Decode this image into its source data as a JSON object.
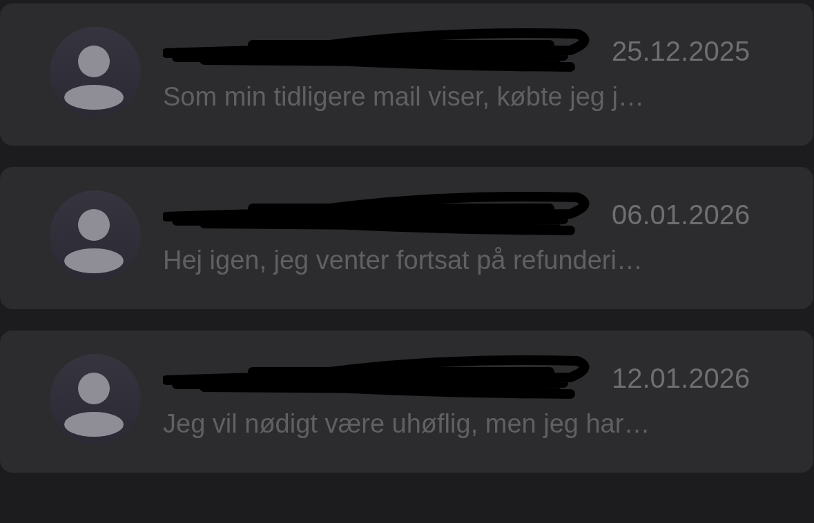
{
  "messages": [
    {
      "sender_redacted": true,
      "date": "25.12.2025",
      "preview": "Som min tidligere mail viser, købte jeg j…"
    },
    {
      "sender_redacted": true,
      "date": "06.01.2026",
      "preview": "Hej igen, jeg venter fortsat på refunderi…"
    },
    {
      "sender_redacted": true,
      "date": "12.01.2026",
      "preview": "Jeg vil nødigt være uhøflig, men jeg har…"
    }
  ]
}
